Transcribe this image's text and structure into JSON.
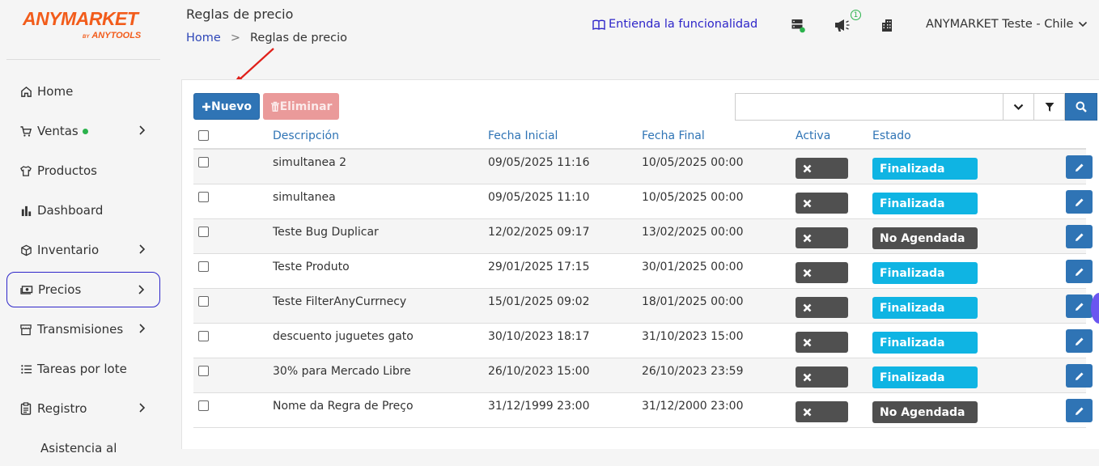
{
  "logo": {
    "brand": "ANYMARKET",
    "by": "BY",
    "sub": "ANYTOOLS"
  },
  "header": {
    "title": "Reglas de precio",
    "breadcrumb": {
      "home": "Home",
      "sep": ">",
      "current": "Reglas de precio"
    },
    "help_link": "Entienda la funcionalidad",
    "notification_count": "1",
    "account": "ANYMARKET Teste - Chile"
  },
  "sidebar": {
    "items": [
      {
        "label": "Home",
        "icon": "home-icon"
      },
      {
        "label": "Ventas",
        "icon": "cart-icon"
      },
      {
        "label": "Productos",
        "icon": "shirt-icon"
      },
      {
        "label": "Dashboard",
        "icon": "bar-chart-icon"
      },
      {
        "label": "Inventario",
        "icon": "box-icon"
      },
      {
        "label": "Precios",
        "icon": "money-icon"
      },
      {
        "label": "Transmisiones",
        "icon": "store-icon"
      },
      {
        "label": "Tareas por lote",
        "icon": "list-icon"
      },
      {
        "label": "Registro",
        "icon": "clipboard-icon"
      },
      {
        "label": "Asistencia al",
        "icon": ""
      }
    ]
  },
  "toolbar": {
    "new_label": "Nuevo",
    "delete_label": "Eliminar",
    "search_value": ""
  },
  "table": {
    "headers": {
      "descripcion": "Descripción",
      "fecha_inicial": "Fecha Inicial",
      "fecha_final": "Fecha Final",
      "activa": "Activa",
      "estado": "Estado"
    },
    "rows": [
      {
        "descripcion": "simultanea 2",
        "fecha_inicial": "09/05/2025 11:16",
        "fecha_final": "10/05/2025 00:00",
        "estado": "Finalizada"
      },
      {
        "descripcion": "simultanea",
        "fecha_inicial": "09/05/2025 11:10",
        "fecha_final": "10/05/2025 00:00",
        "estado": "Finalizada"
      },
      {
        "descripcion": "Teste Bug Duplicar",
        "fecha_inicial": "12/02/2025 09:17",
        "fecha_final": "13/02/2025 00:00",
        "estado": "No Agendada"
      },
      {
        "descripcion": "Teste Produto",
        "fecha_inicial": "29/01/2025 17:15",
        "fecha_final": "30/01/2025 00:00",
        "estado": "Finalizada"
      },
      {
        "descripcion": "Teste FilterAnyCurrnecy",
        "fecha_inicial": "15/01/2025 09:02",
        "fecha_final": "18/01/2025 00:00",
        "estado": "Finalizada"
      },
      {
        "descripcion": "descuento juguetes gato",
        "fecha_inicial": "30/10/2023 18:17",
        "fecha_final": "31/10/2023 15:00",
        "estado": "Finalizada"
      },
      {
        "descripcion": "30% para Mercado Libre",
        "fecha_inicial": "26/10/2023 15:00",
        "fecha_final": "26/10/2023 23:59",
        "estado": "Finalizada"
      },
      {
        "descripcion": "Nome da Regra de Preço",
        "fecha_inicial": "31/12/1999 23:00",
        "fecha_final": "31/12/2000 23:00",
        "estado": "No Agendada"
      }
    ]
  },
  "colors": {
    "primary": "#2f74b5",
    "finalizada": "#0fb4e3",
    "no_agendada": "#4f4f4f",
    "danger_disabled": "#ea9a9a",
    "brand": "#f25c1b"
  }
}
